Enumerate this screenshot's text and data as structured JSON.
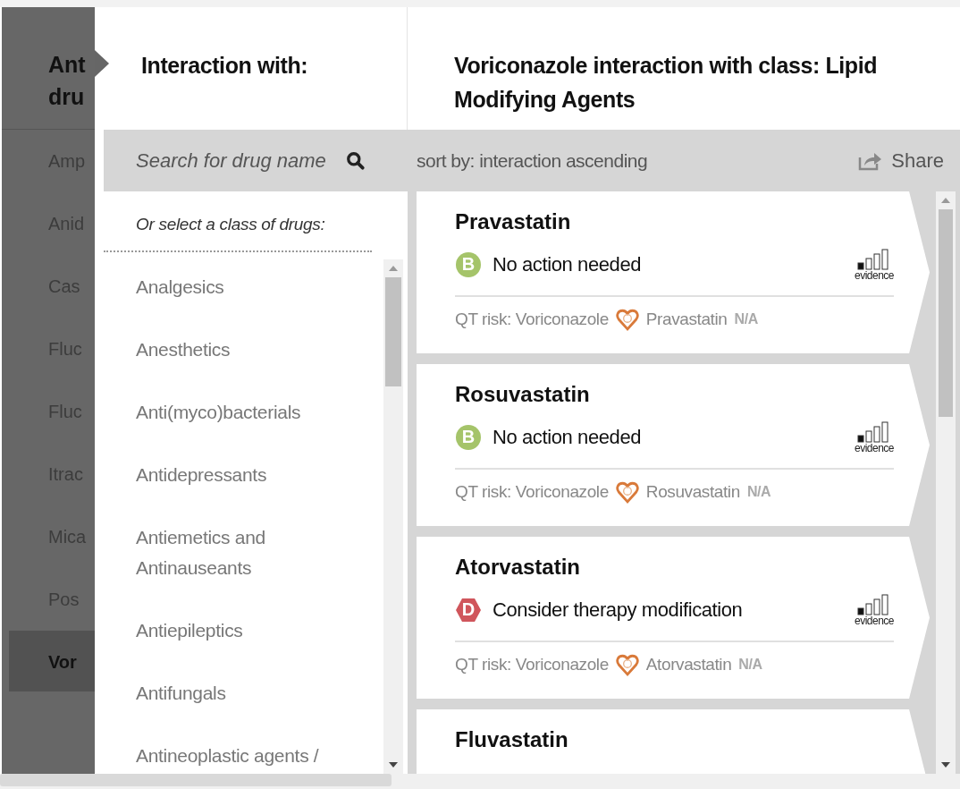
{
  "background_panel": {
    "title_lines": [
      "Ant",
      "dru"
    ],
    "items": [
      {
        "label": "Amp",
        "selected": false
      },
      {
        "label": "Anid",
        "selected": false
      },
      {
        "label": "Cas",
        "selected": false
      },
      {
        "label": "Fluc",
        "selected": false
      },
      {
        "label": "Fluc",
        "selected": false
      },
      {
        "label": "Itrac",
        "selected": false
      },
      {
        "label": "Mica",
        "selected": false
      },
      {
        "label": "Pos",
        "selected": false
      },
      {
        "label": "Vor",
        "selected": true
      }
    ]
  },
  "left_header": {
    "title": "Interaction with:"
  },
  "right_header": {
    "title": "Voriconazole interaction with class: Lipid Modifying Agents"
  },
  "search": {
    "placeholder": "Search for drug name"
  },
  "sort": {
    "label": "sort by: interaction ascending"
  },
  "share": {
    "label": "Share"
  },
  "classes": {
    "prompt": "Or select a class of drugs:",
    "items": [
      "Analgesics",
      "Anesthetics",
      "Anti(myco)bacterials",
      "Antidepressants",
      "Antiemetics and Antinauseants",
      "Antiepileptics",
      "Antifungals",
      "Antineoplastic agents /"
    ]
  },
  "results": [
    {
      "name": "Pravastatin",
      "rating": {
        "letter": "B",
        "kind": "circle",
        "color": "#a5c46a"
      },
      "action": "No action needed",
      "evidence": {
        "label": "evidence",
        "level": 0.25
      },
      "qt": {
        "prefix": "QT risk: Voriconazole",
        "drug": "Pravastatin",
        "value": "N/A"
      }
    },
    {
      "name": "Rosuvastatin",
      "rating": {
        "letter": "B",
        "kind": "circle",
        "color": "#a5c46a"
      },
      "action": "No action needed",
      "evidence": {
        "label": "evidence",
        "level": 0.25
      },
      "qt": {
        "prefix": "QT risk: Voriconazole",
        "drug": "Rosuvastatin",
        "value": "N/A"
      }
    },
    {
      "name": "Atorvastatin",
      "rating": {
        "letter": "D",
        "kind": "hexagon",
        "color": "#d0565c"
      },
      "action": "Consider therapy modification",
      "evidence": {
        "label": "evidence",
        "level": 0.25
      },
      "qt": {
        "prefix": "QT risk: Voriconazole",
        "drug": "Atorvastatin",
        "value": "N/A"
      }
    },
    {
      "name": "Fluvastatin"
    }
  ]
}
